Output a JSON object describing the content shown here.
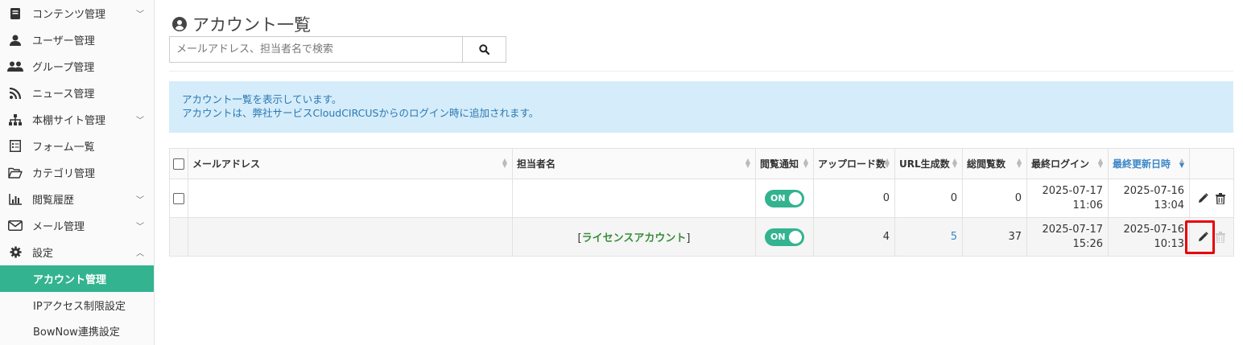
{
  "sidebar": {
    "items": [
      {
        "label": "コンテンツ管理",
        "icon": "book-icon",
        "chevron": "v"
      },
      {
        "label": "ユーザー管理",
        "icon": "user-icon"
      },
      {
        "label": "グループ管理",
        "icon": "users-icon"
      },
      {
        "label": "ニュース管理",
        "icon": "rss-icon"
      },
      {
        "label": "本棚サイト管理",
        "icon": "sitemap-icon",
        "chevron": "v"
      },
      {
        "label": "フォーム一覧",
        "icon": "form-icon"
      },
      {
        "label": "カテゴリ管理",
        "icon": "folder-open-icon"
      },
      {
        "label": "閲覧履歴",
        "icon": "bar-chart-icon",
        "chevron": "v"
      },
      {
        "label": "メール管理",
        "icon": "envelope-icon",
        "chevron": "v"
      },
      {
        "label": "設定",
        "icon": "gear-icon",
        "chevron": "^"
      }
    ],
    "sub": {
      "active": "アカウント管理",
      "ip": "IPアクセス制限設定",
      "bownow": "BowNow連携設定"
    }
  },
  "page": {
    "title": "アカウント一覧",
    "title_icon": "user-circle-icon"
  },
  "search": {
    "placeholder": "メールアドレス、担当者名で検索",
    "value": ""
  },
  "info": {
    "line1": "アカウント一覧を表示しています。",
    "line2": "アカウントは、弊社サービスCloudCIRCUSからのログイン時に追加されます。"
  },
  "table": {
    "headers": {
      "email": "メールアドレス",
      "name": "担当者名",
      "notify": "閲覧通知",
      "upload": "アップロード数",
      "url": "URL生成数",
      "views": "総閲覧数",
      "last_login": "最終ログイン",
      "updated": "最終更新日時"
    },
    "rows": [
      {
        "email": "",
        "name": "",
        "notify": "ON",
        "upload": "0",
        "url": "0",
        "views": "0",
        "last_login_date": "2025-07-17",
        "last_login_time": "11:06",
        "updated_date": "2025-07-16",
        "updated_time": "13:04"
      },
      {
        "email": "",
        "name_prefix": "[",
        "name_label": "ライセンスアカウント",
        "name_suffix": "]",
        "notify": "ON",
        "upload": "4",
        "url": "5",
        "views": "37",
        "last_login_date": "2025-07-17",
        "last_login_time": "15:26",
        "updated_date": "2025-07-16",
        "updated_time": "10:13"
      }
    ]
  },
  "colors": {
    "accent": "#33b38f",
    "info_bg": "#d5ecfa",
    "info_text": "#2b79b3",
    "link": "#3a86c8",
    "highlight": "#e8000b"
  }
}
